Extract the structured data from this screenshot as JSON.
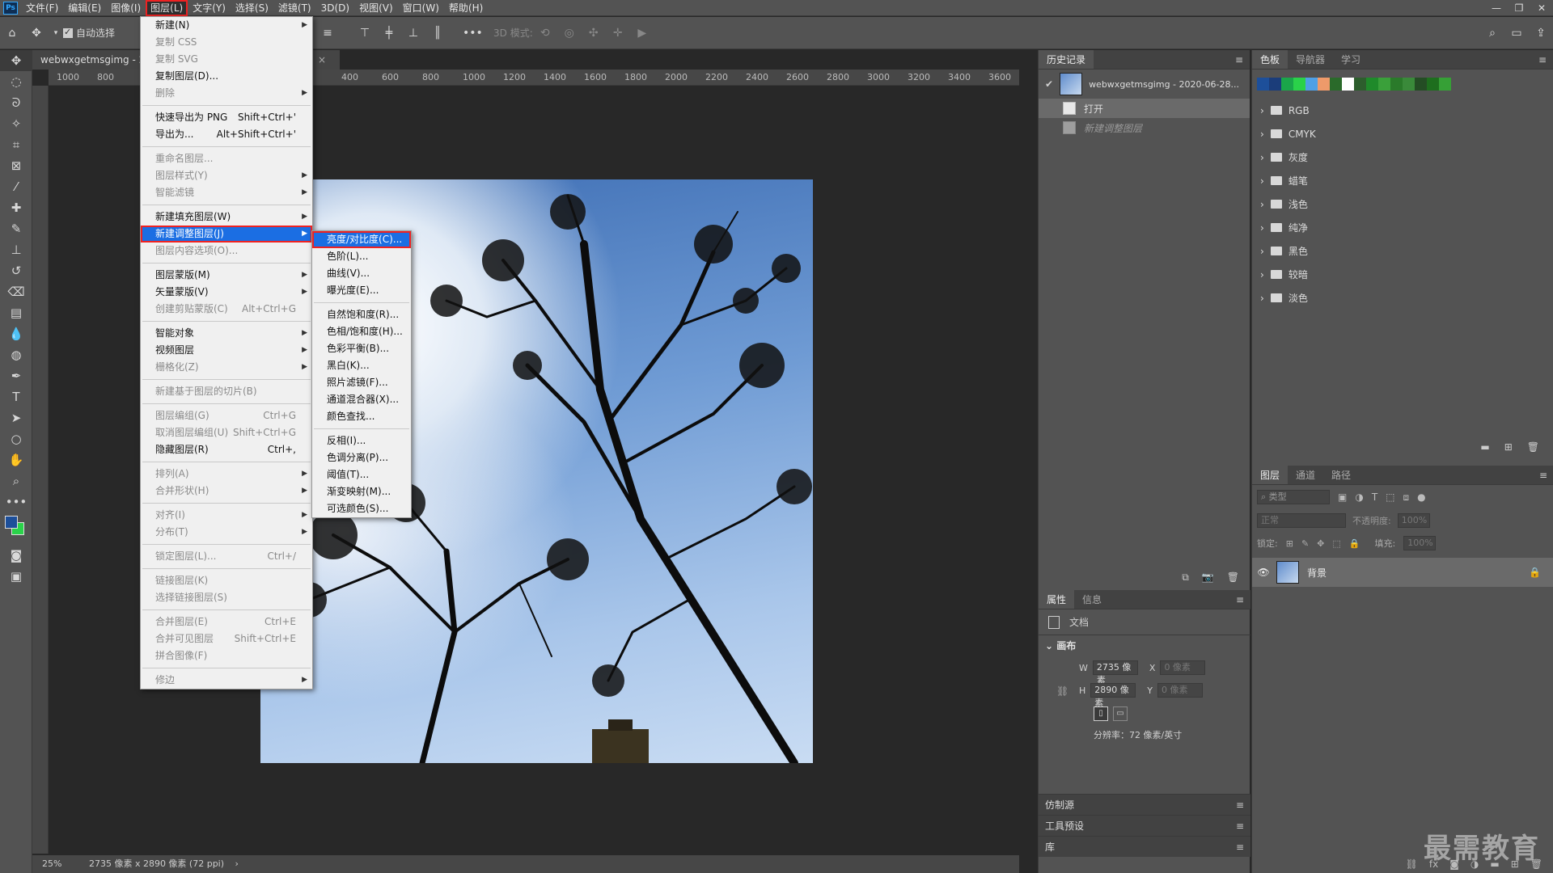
{
  "app": {
    "logo": "Ps"
  },
  "menubar": {
    "items": [
      "文件(F)",
      "编辑(E)",
      "图像(I)",
      "图层(L)",
      "文字(Y)",
      "选择(S)",
      "滤镜(T)",
      "3D(D)",
      "视图(V)",
      "窗口(W)",
      "帮助(H)"
    ],
    "active_index": 3,
    "window_controls": [
      "—",
      "❐",
      "✕"
    ]
  },
  "options_bar": {
    "auto_select_label": "自动选择",
    "mode3d_label": "3D 模式:"
  },
  "document": {
    "tab_title": "webwxgetmsgimg - 20...",
    "ruler_left_ticks": [
      "1000",
      "800"
    ],
    "ruler_right_ticks": [
      "400",
      "600",
      "800",
      "1000",
      "1200",
      "1400",
      "1600",
      "1800",
      "2000",
      "2200",
      "2400",
      "2600",
      "2800",
      "3000",
      "3200",
      "3400",
      "3600"
    ],
    "status_zoom": "25%",
    "status_info": "2735 像素 x 2890 像素 (72 ppi)"
  },
  "layer_menu": {
    "items": [
      {
        "label": "新建(N)",
        "shortcut": "",
        "submenu": true,
        "disabled": false
      },
      {
        "label": "复制 CSS",
        "shortcut": "",
        "submenu": false,
        "disabled": true
      },
      {
        "label": "复制 SVG",
        "shortcut": "",
        "submenu": false,
        "disabled": true
      },
      {
        "label": "复制图层(D)...",
        "shortcut": "",
        "submenu": false,
        "disabled": false
      },
      {
        "label": "删除",
        "shortcut": "",
        "submenu": true,
        "disabled": true
      },
      {
        "sep": true
      },
      {
        "label": "快速导出为 PNG",
        "shortcut": "Shift+Ctrl+'",
        "submenu": false,
        "disabled": false
      },
      {
        "label": "导出为...",
        "shortcut": "Alt+Shift+Ctrl+'",
        "submenu": false,
        "disabled": false
      },
      {
        "sep": true
      },
      {
        "label": "重命名图层...",
        "shortcut": "",
        "submenu": false,
        "disabled": true
      },
      {
        "label": "图层样式(Y)",
        "shortcut": "",
        "submenu": true,
        "disabled": true
      },
      {
        "label": "智能滤镜",
        "shortcut": "",
        "submenu": true,
        "disabled": true
      },
      {
        "sep": true
      },
      {
        "label": "新建填充图层(W)",
        "shortcut": "",
        "submenu": true,
        "disabled": false
      },
      {
        "label": "新建调整图层(J)",
        "shortcut": "",
        "submenu": true,
        "disabled": false,
        "highlight": true
      },
      {
        "label": "图层内容选项(O)...",
        "shortcut": "",
        "submenu": false,
        "disabled": true
      },
      {
        "sep": true
      },
      {
        "label": "图层蒙版(M)",
        "shortcut": "",
        "submenu": true,
        "disabled": false
      },
      {
        "label": "矢量蒙版(V)",
        "shortcut": "",
        "submenu": true,
        "disabled": false
      },
      {
        "label": "创建剪贴蒙版(C)",
        "shortcut": "Alt+Ctrl+G",
        "submenu": false,
        "disabled": true
      },
      {
        "sep": true
      },
      {
        "label": "智能对象",
        "shortcut": "",
        "submenu": true,
        "disabled": false
      },
      {
        "label": "视频图层",
        "shortcut": "",
        "submenu": true,
        "disabled": false
      },
      {
        "label": "栅格化(Z)",
        "shortcut": "",
        "submenu": true,
        "disabled": true
      },
      {
        "sep": true
      },
      {
        "label": "新建基于图层的切片(B)",
        "shortcut": "",
        "submenu": false,
        "disabled": true
      },
      {
        "sep": true
      },
      {
        "label": "图层编组(G)",
        "shortcut": "Ctrl+G",
        "submenu": false,
        "disabled": true
      },
      {
        "label": "取消图层编组(U)",
        "shortcut": "Shift+Ctrl+G",
        "submenu": false,
        "disabled": true
      },
      {
        "label": "隐藏图层(R)",
        "shortcut": "Ctrl+,",
        "submenu": false,
        "disabled": false
      },
      {
        "sep": true
      },
      {
        "label": "排列(A)",
        "shortcut": "",
        "submenu": true,
        "disabled": true
      },
      {
        "label": "合并形状(H)",
        "shortcut": "",
        "submenu": true,
        "disabled": true
      },
      {
        "sep": true
      },
      {
        "label": "对齐(I)",
        "shortcut": "",
        "submenu": true,
        "disabled": true
      },
      {
        "label": "分布(T)",
        "shortcut": "",
        "submenu": true,
        "disabled": true
      },
      {
        "sep": true
      },
      {
        "label": "锁定图层(L)...",
        "shortcut": "Ctrl+/",
        "submenu": false,
        "disabled": true
      },
      {
        "sep": true
      },
      {
        "label": "链接图层(K)",
        "shortcut": "",
        "submenu": false,
        "disabled": true
      },
      {
        "label": "选择链接图层(S)",
        "shortcut": "",
        "submenu": false,
        "disabled": true
      },
      {
        "sep": true
      },
      {
        "label": "合并图层(E)",
        "shortcut": "Ctrl+E",
        "submenu": false,
        "disabled": true
      },
      {
        "label": "合并可见图层",
        "shortcut": "Shift+Ctrl+E",
        "submenu": false,
        "disabled": true
      },
      {
        "label": "拼合图像(F)",
        "shortcut": "",
        "submenu": false,
        "disabled": true
      },
      {
        "sep": true
      },
      {
        "label": "修边",
        "shortcut": "",
        "submenu": true,
        "disabled": true
      }
    ]
  },
  "adjust_submenu": {
    "items": [
      {
        "label": "亮度/对比度(C)...",
        "highlight": true
      },
      {
        "label": "色阶(L)..."
      },
      {
        "label": "曲线(V)..."
      },
      {
        "label": "曝光度(E)..."
      },
      {
        "sep": true
      },
      {
        "label": "自然饱和度(R)..."
      },
      {
        "label": "色相/饱和度(H)..."
      },
      {
        "label": "色彩平衡(B)..."
      },
      {
        "label": "黑白(K)..."
      },
      {
        "label": "照片滤镜(F)..."
      },
      {
        "label": "通道混合器(X)..."
      },
      {
        "label": "颜色查找..."
      },
      {
        "sep": true
      },
      {
        "label": "反相(I)..."
      },
      {
        "label": "色调分离(P)..."
      },
      {
        "label": "阈值(T)..."
      },
      {
        "label": "渐变映射(M)..."
      },
      {
        "label": "可选颜色(S)..."
      }
    ]
  },
  "history_panel": {
    "tab": "历史记录",
    "snapshot": "webwxgetmsgimg - 2020-06-28...",
    "rows": [
      "打开",
      "新建调整图层"
    ]
  },
  "properties_panel": {
    "tabs": [
      "属性",
      "信息"
    ],
    "doc_label": "文档",
    "section": "画布",
    "w_label": "W",
    "w_value": "2735 像素",
    "h_label": "H",
    "h_value": "2890 像素",
    "x_label": "X",
    "x_value": "0 像素",
    "y_label": "Y",
    "y_value": "0 像素",
    "resolution": "分辨率：72 像素/英寸"
  },
  "collapsed_panels": [
    "仿制源",
    "工具预设",
    "库"
  ],
  "swatches_panel": {
    "tabs": [
      "色板",
      "导航器",
      "学习"
    ],
    "colors": [
      "#1d4f9a",
      "#1b3d7a",
      "#1aa64a",
      "#2ad24a",
      "#4fa0e6",
      "#ee9a6a",
      "#2a6a2a",
      "#ffffff",
      "#2d5e2d",
      "#1f8a2a",
      "#3aa03a",
      "#2a7a2a",
      "#3a8a3a",
      "#244d24",
      "#1e6e1e",
      "#36a036"
    ],
    "groups": [
      "RGB",
      "CMYK",
      "灰度",
      "蜡笔",
      "浅色",
      "纯净",
      "黑色",
      "较暗",
      "淡色"
    ]
  },
  "layers_panel": {
    "tabs": [
      "图层",
      "通道",
      "路径"
    ],
    "filter_placeholder": "类型",
    "blend_mode": "正常",
    "opacity_label": "不透明度:",
    "opacity_value": "100%",
    "lock_label": "锁定:",
    "fill_label": "填充:",
    "fill_value": "100%",
    "layer_name": "背景"
  },
  "watermark": "最需教育"
}
